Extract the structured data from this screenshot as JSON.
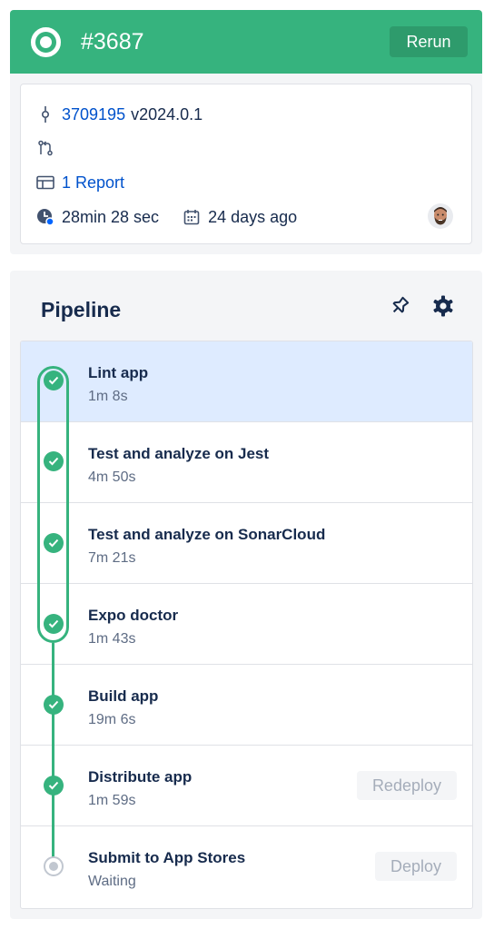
{
  "header": {
    "build_number": "#3687",
    "rerun_label": "Rerun",
    "status_icon": "status-ring-icon",
    "color": "#36b37e"
  },
  "info": {
    "commit_hash": "3709195",
    "commit_message": "v2024.0.1",
    "report_link": "1 Report",
    "duration": "28min 28 sec",
    "date": "24 days ago"
  },
  "pipeline": {
    "title": "Pipeline",
    "steps": [
      {
        "name": "Lint app",
        "detail": "1m 8s",
        "status": "success"
      },
      {
        "name": "Test and analyze on Jest",
        "detail": "4m 50s",
        "status": "success"
      },
      {
        "name": "Test and analyze on SonarCloud",
        "detail": "7m 21s",
        "status": "success"
      },
      {
        "name": "Expo doctor",
        "detail": "1m 43s",
        "status": "success"
      },
      {
        "name": "Build app",
        "detail": "19m 6s",
        "status": "success"
      },
      {
        "name": "Distribute app",
        "detail": "1m 59s",
        "status": "success",
        "action": "Redeploy"
      },
      {
        "name": "Submit to App Stores",
        "detail": "Waiting",
        "status": "pending",
        "action": "Deploy"
      }
    ]
  },
  "colors": {
    "success": "#36b37e",
    "link": "#0052cc",
    "selected": "#deebff"
  }
}
